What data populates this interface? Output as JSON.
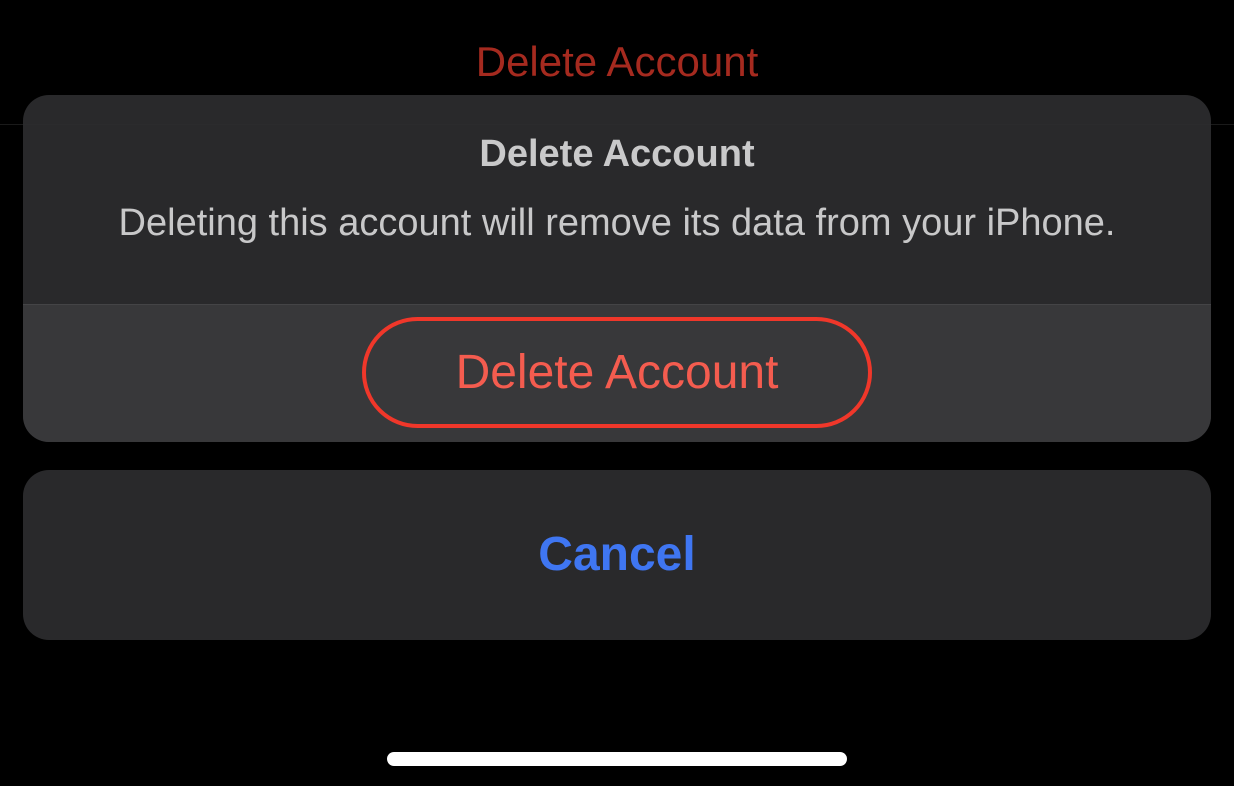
{
  "background": {
    "header_title": "Delete Account"
  },
  "action_sheet": {
    "title": "Delete Account",
    "message": "Deleting this account will remove its data from your iPhone.",
    "destructive_action_label": "Delete Account",
    "cancel_label": "Cancel"
  },
  "colors": {
    "destructive": "#f0372a",
    "destructive_text": "#f45c4f",
    "primary_blue": "#3f76f2",
    "sheet_bg": "rgba(45,45,47,0.92)"
  }
}
